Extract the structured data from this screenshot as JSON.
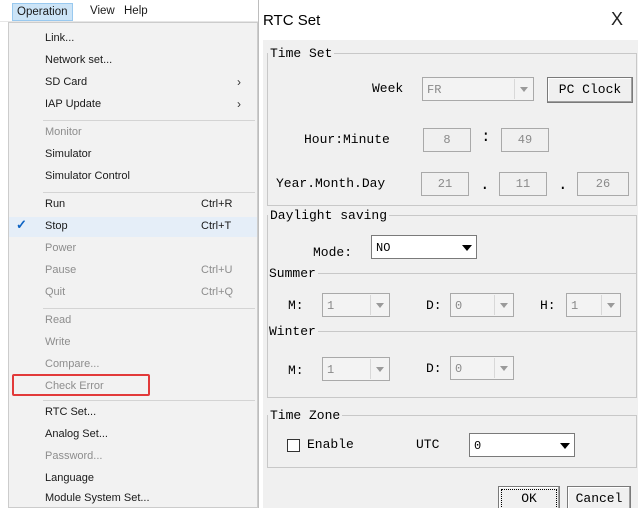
{
  "menubar": {
    "items": [
      {
        "label": "Operation"
      },
      {
        "label": "View"
      },
      {
        "label": "Help"
      }
    ]
  },
  "dropdown": {
    "items": [
      {
        "label": "Link..."
      },
      {
        "label": "Network set..."
      },
      {
        "label": "SD Card",
        "arrow": "›"
      },
      {
        "label": "IAP Update",
        "arrow": "›"
      },
      {
        "label": "Monitor"
      },
      {
        "label": "Simulator"
      },
      {
        "label": "Simulator Control"
      },
      {
        "label": "Run",
        "shortcut": "Ctrl+R"
      },
      {
        "label": "Stop",
        "shortcut": "Ctrl+T",
        "check": "✓"
      },
      {
        "label": "Power"
      },
      {
        "label": "Pause",
        "shortcut": "Ctrl+U"
      },
      {
        "label": "Quit",
        "shortcut": "Ctrl+Q"
      },
      {
        "label": "Read"
      },
      {
        "label": "Write"
      },
      {
        "label": "Compare..."
      },
      {
        "label": "Check Error"
      },
      {
        "label": "RTC Set..."
      },
      {
        "label": "Analog Set..."
      },
      {
        "label": "Password..."
      },
      {
        "label": "Language"
      },
      {
        "label": "Module System Set..."
      }
    ]
  },
  "dialog": {
    "title": "RTC Set",
    "close": "X",
    "time_set": {
      "legend": "Time Set",
      "week_label": "Week",
      "week_value": "FR",
      "pc_clock": "PC Clock",
      "hm_label": "Hour:Minute",
      "hour": "8",
      "minute": "49",
      "colon": ":",
      "ymd_label": "Year.Month.Day",
      "year": "21",
      "month": "11",
      "day": "26",
      "dot": "."
    },
    "daylight": {
      "legend": "Daylight saving",
      "mode_label": "Mode:",
      "mode_value": "NO",
      "summer_label": "Summer",
      "winter_label": "Winter",
      "m_label": "M:",
      "d_label": "D:",
      "h_label": "H:",
      "summer_m": "1",
      "summer_d": "0",
      "summer_h": "1",
      "winter_m": "1",
      "winter_d": "0"
    },
    "time_zone": {
      "legend": "Time Zone",
      "enable_label": "Enable",
      "utc_label": "UTC",
      "utc_value": "0"
    },
    "ok": "OK",
    "cancel": "Cancel"
  },
  "colors": {
    "highlight": "#e23a3a",
    "check": "#0d63c3",
    "menu_active": "#cce4f7"
  }
}
